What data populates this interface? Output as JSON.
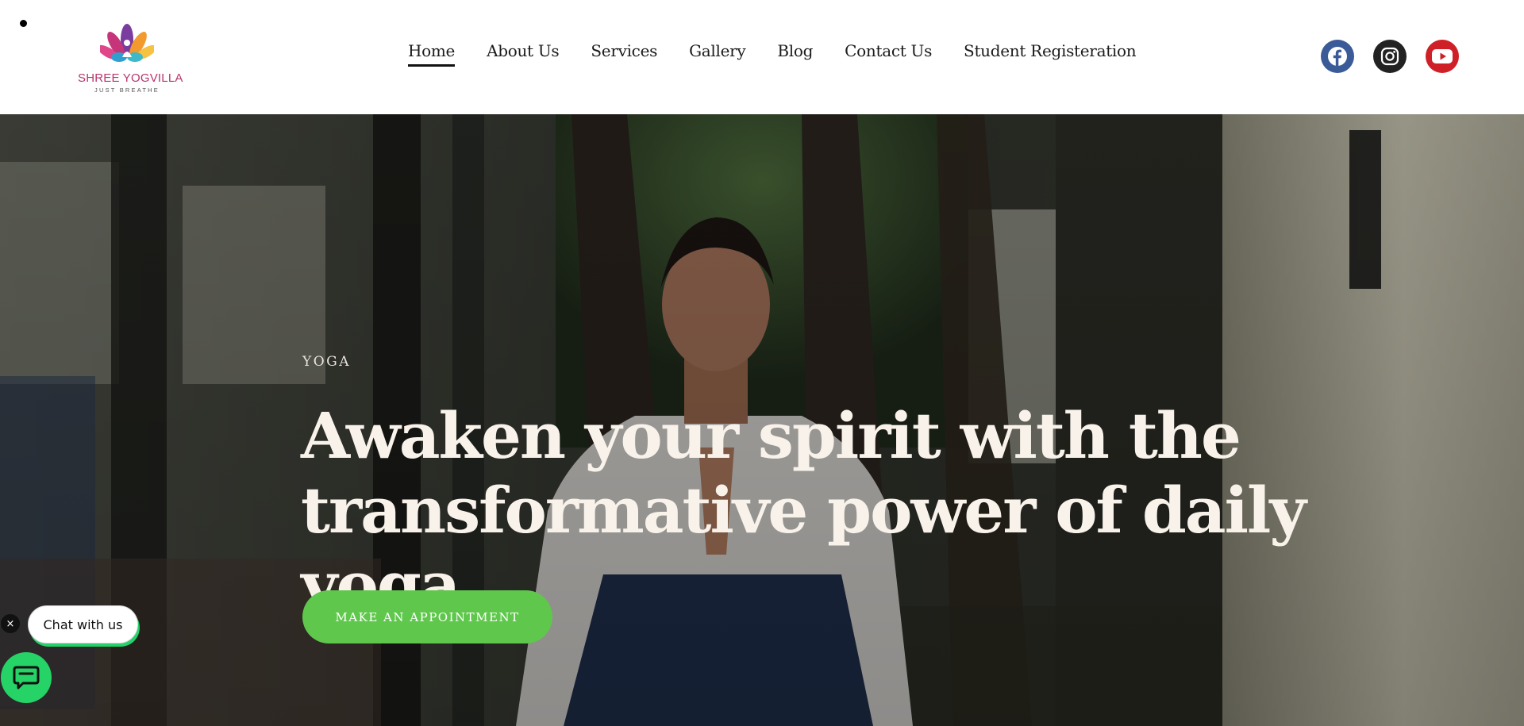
{
  "brand": {
    "name": "SHREE YOGVILLA",
    "tagline": "JUST BREATHE"
  },
  "nav": {
    "items": [
      {
        "label": "Home",
        "active": true
      },
      {
        "label": "About Us",
        "active": false
      },
      {
        "label": "Services",
        "active": false
      },
      {
        "label": "Gallery",
        "active": false
      },
      {
        "label": "Blog",
        "active": false
      },
      {
        "label": "Contact Us",
        "active": false
      },
      {
        "label": "Student Registeration",
        "active": false
      }
    ]
  },
  "social": [
    {
      "icon": "facebook-icon",
      "color": "#3a5a98"
    },
    {
      "icon": "instagram-icon",
      "color": "#222222"
    },
    {
      "icon": "youtube-icon",
      "color": "#cf2027"
    }
  ],
  "hero": {
    "eyebrow": "YOGA",
    "title": "Awaken your spirit with the transformative power of daily yoga",
    "cta_label": "MAKE AN APPOINTMENT"
  },
  "chat": {
    "label": "Chat with us",
    "close_symbol": "×"
  },
  "colors": {
    "accent_green": "#5fc84c",
    "whatsapp_green": "#25d366",
    "logo_text": "#b8356c"
  }
}
